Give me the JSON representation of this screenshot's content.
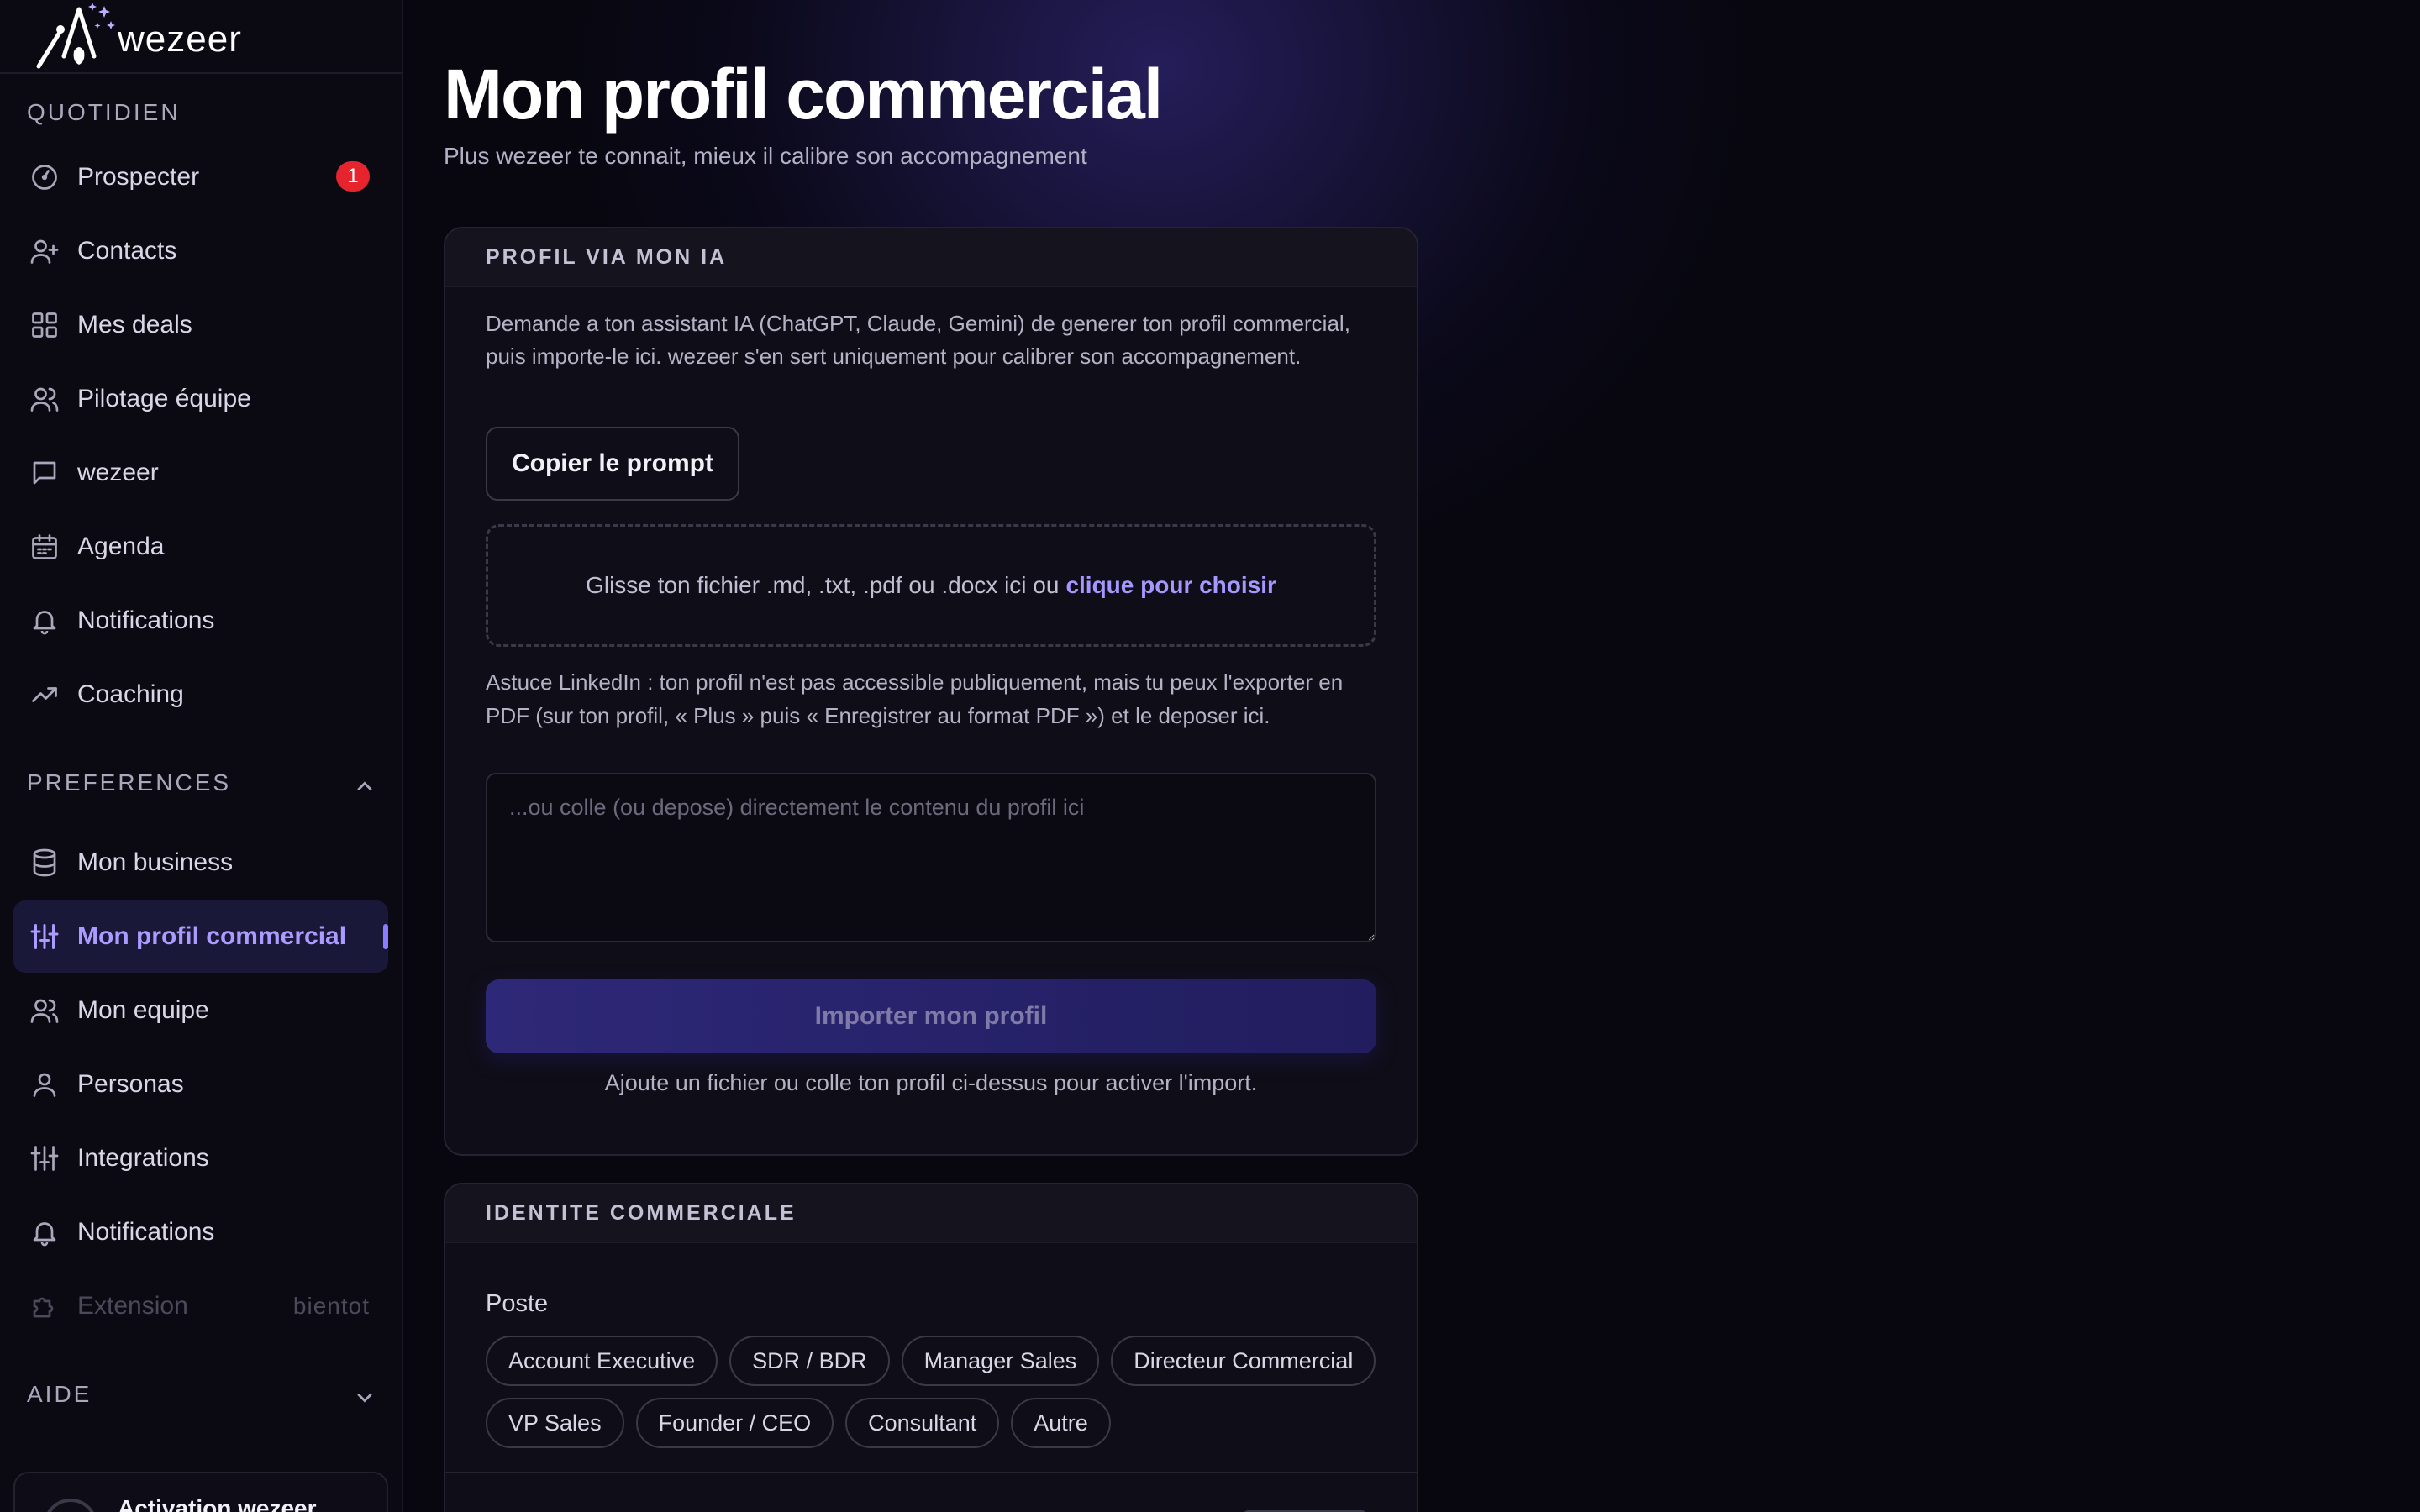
{
  "brand": {
    "name": "wezeer"
  },
  "sidebar": {
    "sections": {
      "daily": "QUOTIDIEN",
      "preferences": "PREFERENCES",
      "help": "AIDE"
    },
    "daily_items": [
      {
        "label": "Prospecter",
        "icon": "compass-icon",
        "badge": "1"
      },
      {
        "label": "Contacts",
        "icon": "user-plus-icon"
      },
      {
        "label": "Mes deals",
        "icon": "grid-icon"
      },
      {
        "label": "Pilotage équipe",
        "icon": "users-icon"
      },
      {
        "label": "wezeer",
        "icon": "chat-icon"
      },
      {
        "label": "Agenda",
        "icon": "calendar-icon"
      },
      {
        "label": "Notifications",
        "icon": "bell-icon"
      },
      {
        "label": "Coaching",
        "icon": "trending-up-icon"
      }
    ],
    "preference_items": [
      {
        "label": "Mon business",
        "icon": "database-icon"
      },
      {
        "label": "Mon profil commercial",
        "icon": "sliders-icon",
        "active": true
      },
      {
        "label": "Mon equipe",
        "icon": "users-icon"
      },
      {
        "label": "Personas",
        "icon": "user-icon"
      },
      {
        "label": "Integrations",
        "icon": "sliders-icon"
      },
      {
        "label": "Notifications",
        "icon": "bell-icon"
      },
      {
        "label": "Extension",
        "icon": "puzzle-icon",
        "disabled": true,
        "soon": "bientot"
      }
    ],
    "activation": {
      "label": "Activation wezeer"
    }
  },
  "main": {
    "title": "Mon profil commercial",
    "subtitle": "Plus wezeer te connait, mieux il calibre son accompagnement",
    "ai_card": {
      "header": "PROFIL VIA MON IA",
      "description": "Demande a ton assistant IA (ChatGPT, Claude, Gemini) de generer ton profil commercial, puis importe-le ici. wezeer s'en sert uniquement pour calibrer son accompagnement.",
      "copy_button": "Copier le prompt",
      "dropzone_text": "Glisse ton fichier .md, .txt, .pdf ou .docx ici ou",
      "dropzone_link": "clique pour choisir",
      "tip": "Astuce LinkedIn : ton profil n'est pas accessible publiquement, mais tu peux l'exporter en PDF (sur ton profil, « Plus » puis « Enregistrer au format PDF ») et le deposer ici.",
      "paste_placeholder": "...ou colle (ou depose) directement le contenu du profil ici",
      "paste_value": "",
      "import_button": "Importer mon profil",
      "helper": "Ajoute un fichier ou colle ton profil ci-dessus pour activer l'import."
    },
    "identity_card": {
      "header": "IDENTITE COMMERCIALE",
      "field_label": "Poste",
      "roles_row1": [
        "Account Executive",
        "SDR / BDR",
        "Manager Sales",
        "Directeur Commercial"
      ],
      "roles_row2": [
        "VP Sales",
        "Founder / CEO",
        "Consultant",
        "Autre"
      ]
    }
  },
  "colors": {
    "accent": "#a597ff",
    "active_bg": "#1a1838",
    "badge": "#e5242e",
    "primary_button": "#2e2878"
  }
}
